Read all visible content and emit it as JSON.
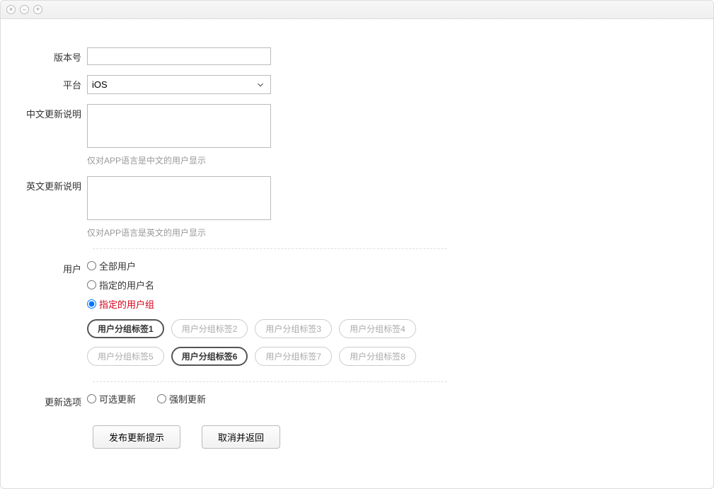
{
  "titlebar": {
    "close": "×",
    "minimize": "–",
    "zoom": "+"
  },
  "form": {
    "version_label": "版本号",
    "version_value": "",
    "platform_label": "平台",
    "platform_value": "iOS",
    "cn_desc_label": "中文更新说明",
    "cn_desc_value": "",
    "cn_desc_hint": "仅对APP语言是中文的用户显示",
    "en_desc_label": "英文更新说明",
    "en_desc_value": "",
    "en_desc_hint": "仅对APP语言是英文的用户显示",
    "user_label": "用户",
    "user_options": [
      {
        "label": "全部用户",
        "selected": false
      },
      {
        "label": "指定的用户名",
        "selected": false
      },
      {
        "label": "指定的用户组",
        "selected": true
      }
    ],
    "group_tags_row1": [
      {
        "label": "用户分组标签1",
        "active": true
      },
      {
        "label": "用户分组标签2",
        "active": false
      },
      {
        "label": "用户分组标签3",
        "active": false
      },
      {
        "label": "用户分组标签4",
        "active": false
      }
    ],
    "group_tags_row2": [
      {
        "label": "用户分组标签5",
        "active": false
      },
      {
        "label": "用户分组标签6",
        "active": true
      },
      {
        "label": "用户分组标签7",
        "active": false
      },
      {
        "label": "用户分组标签8",
        "active": false
      }
    ],
    "update_option_label": "更新选项",
    "update_options": [
      {
        "label": "可选更新",
        "selected": false
      },
      {
        "label": "强制更新",
        "selected": false
      }
    ],
    "submit_label": "发布更新提示",
    "cancel_label": "取消并返回"
  }
}
